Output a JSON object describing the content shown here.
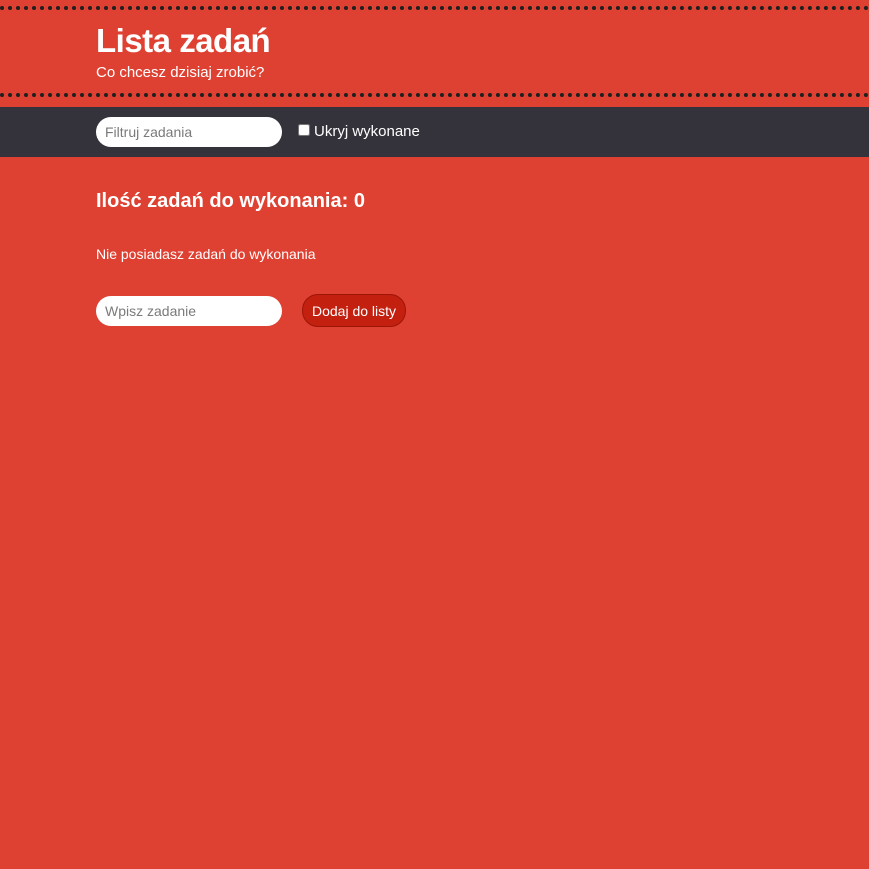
{
  "header": {
    "title": "Lista zadań",
    "subtitle": "Co chcesz dzisiaj zrobić?"
  },
  "toolbar": {
    "filter_placeholder": "Filtruj zadania",
    "filter_value": "",
    "hide_done_label": "Ukryj wykonane",
    "hide_done_checked": false
  },
  "main": {
    "count_heading": "Ilość zadań do wykonania: 0",
    "empty_message": "Nie posiadasz zadań do wykonania",
    "task_placeholder": "Wpisz zadanie",
    "task_value": "",
    "add_button_label": "Dodaj do listy"
  },
  "colors": {
    "background": "#de4132",
    "toolbar": "#34323a",
    "button": "#c3200f",
    "text": "#ffffff"
  }
}
